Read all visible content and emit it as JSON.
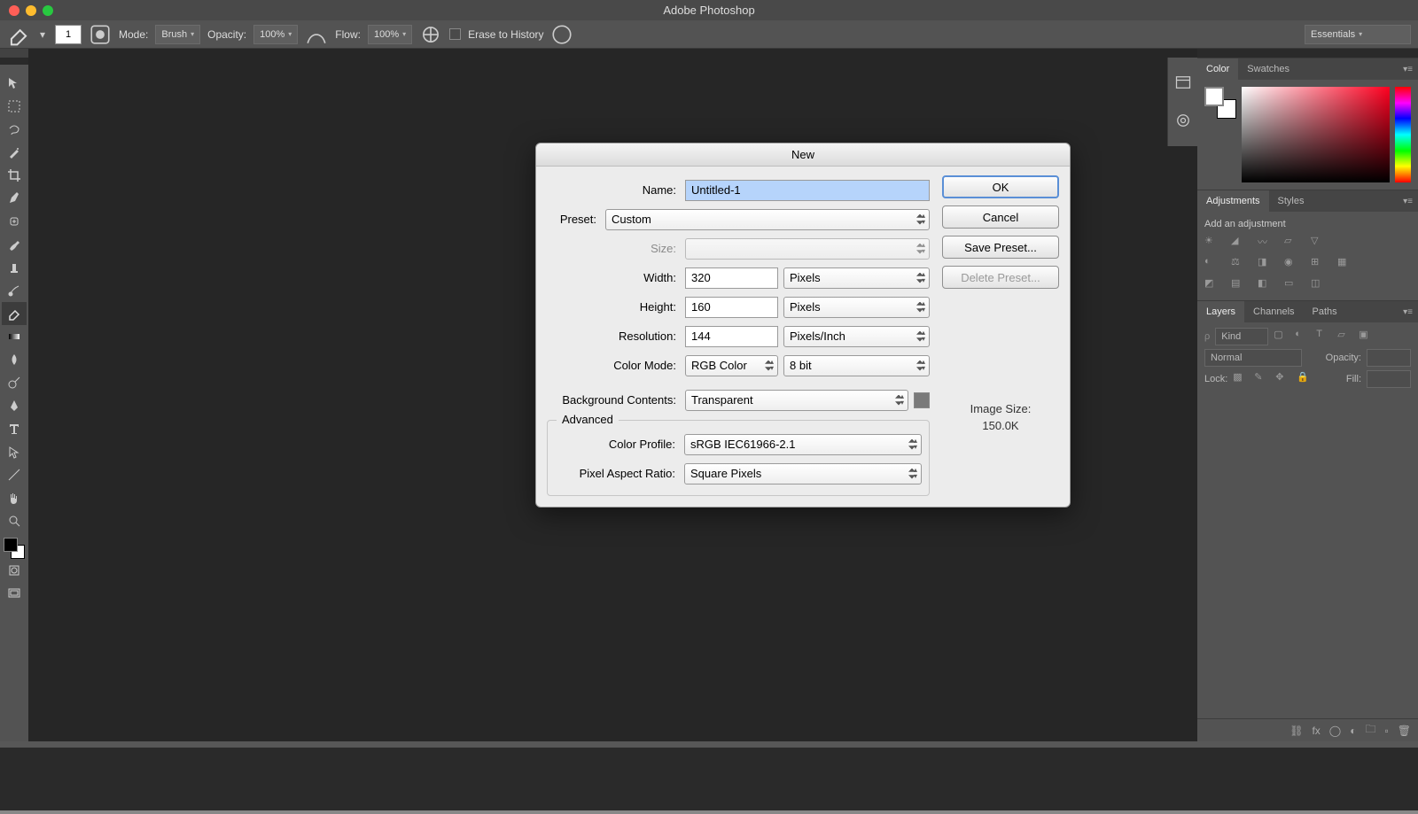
{
  "titlebar": {
    "app_name": "Adobe Photoshop"
  },
  "optionsbar": {
    "brush_size_value": "1",
    "mode_label": "Mode:",
    "mode_value": "Brush",
    "opacity_label": "Opacity:",
    "opacity_value": "100%",
    "flow_label": "Flow:",
    "flow_value": "100%",
    "erase_to_history_label": "Erase to History",
    "workspace_value": "Essentials"
  },
  "panels": {
    "color_tab": "Color",
    "swatches_tab": "Swatches",
    "adjustments_tab": "Adjustments",
    "styles_tab": "Styles",
    "add_adjustment_label": "Add an adjustment",
    "layers_tab": "Layers",
    "channels_tab": "Channels",
    "paths_tab": "Paths",
    "layers": {
      "filter_kind": "Kind",
      "blend_mode": "Normal",
      "opacity_label": "Opacity:",
      "lock_label": "Lock:",
      "fill_label": "Fill:"
    }
  },
  "dialog": {
    "title": "New",
    "name_label": "Name:",
    "name_value": "Untitled-1",
    "preset_label": "Preset:",
    "preset_value": "Custom",
    "size_label": "Size:",
    "size_value": "",
    "width_label": "Width:",
    "width_value": "320",
    "width_unit": "Pixels",
    "height_label": "Height:",
    "height_value": "160",
    "height_unit": "Pixels",
    "resolution_label": "Resolution:",
    "resolution_value": "144",
    "resolution_unit": "Pixels/Inch",
    "color_mode_label": "Color Mode:",
    "color_mode_value": "RGB Color",
    "color_depth_value": "8 bit",
    "bg_label": "Background Contents:",
    "bg_value": "Transparent",
    "advanced_label": "Advanced",
    "color_profile_label": "Color Profile:",
    "color_profile_value": "sRGB IEC61966-2.1",
    "par_label": "Pixel Aspect Ratio:",
    "par_value": "Square Pixels",
    "ok_label": "OK",
    "cancel_label": "Cancel",
    "save_preset_label": "Save Preset...",
    "delete_preset_label": "Delete Preset...",
    "image_size_label": "Image Size:",
    "image_size_value": "150.0K"
  }
}
